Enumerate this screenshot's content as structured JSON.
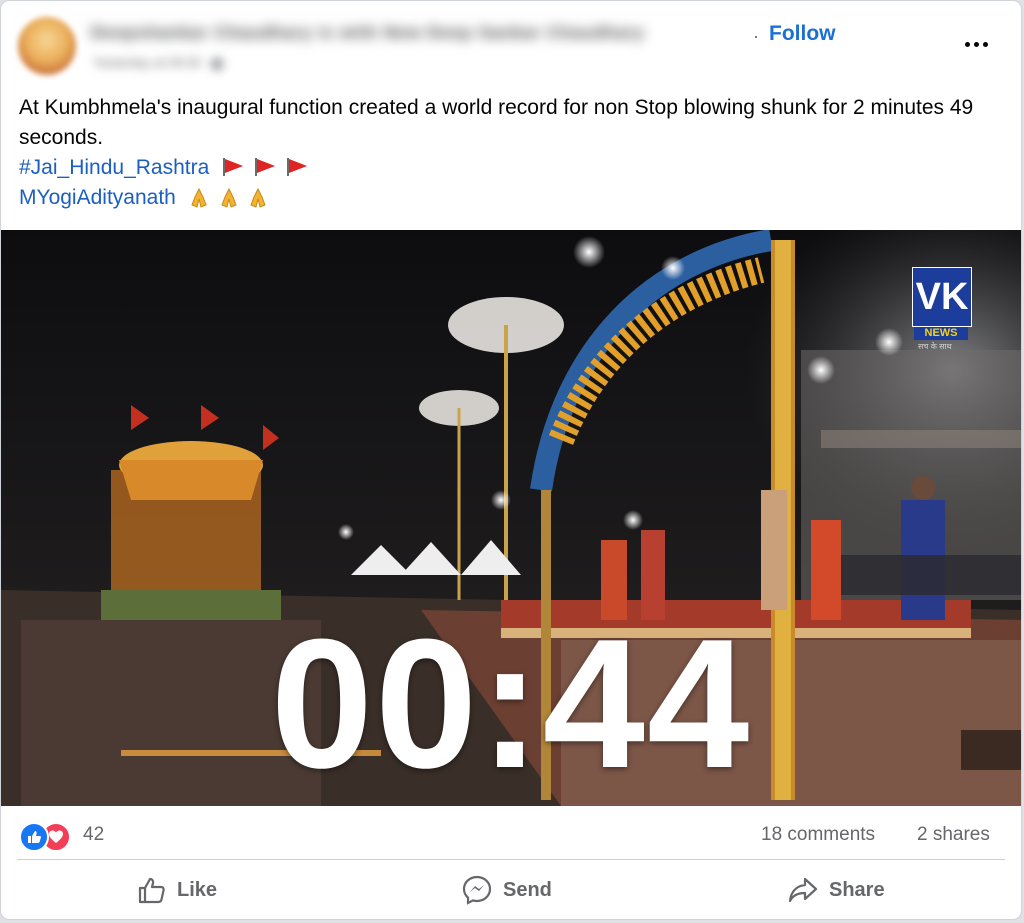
{
  "post": {
    "author_name": "Deepshankar Chaudhary is with New Deep Sankar Chaudhary",
    "meta": "Yesterday at 09:30",
    "follow_label": "Follow",
    "text_line": "At Kumbhmela's inaugural function created a world record for non Stop blowing shunk for 2 minutes 49 seconds.",
    "hashtag": "#Jai_Hindu_Rashtra",
    "mention": "MYogiAdityanath"
  },
  "video": {
    "timer": "00:44",
    "logo_main": "VK",
    "logo_sub": "NEWS",
    "logo_tag": "सच के साथ"
  },
  "stats": {
    "reaction_count": "42",
    "comments": "18 comments",
    "shares": "2 shares"
  },
  "actions": {
    "like": "Like",
    "send": "Send",
    "share": "Share"
  },
  "colors": {
    "accent": "#1b6fd6",
    "like_blue": "#1877f2",
    "love_red": "#f33e58",
    "muted": "#65676b"
  }
}
